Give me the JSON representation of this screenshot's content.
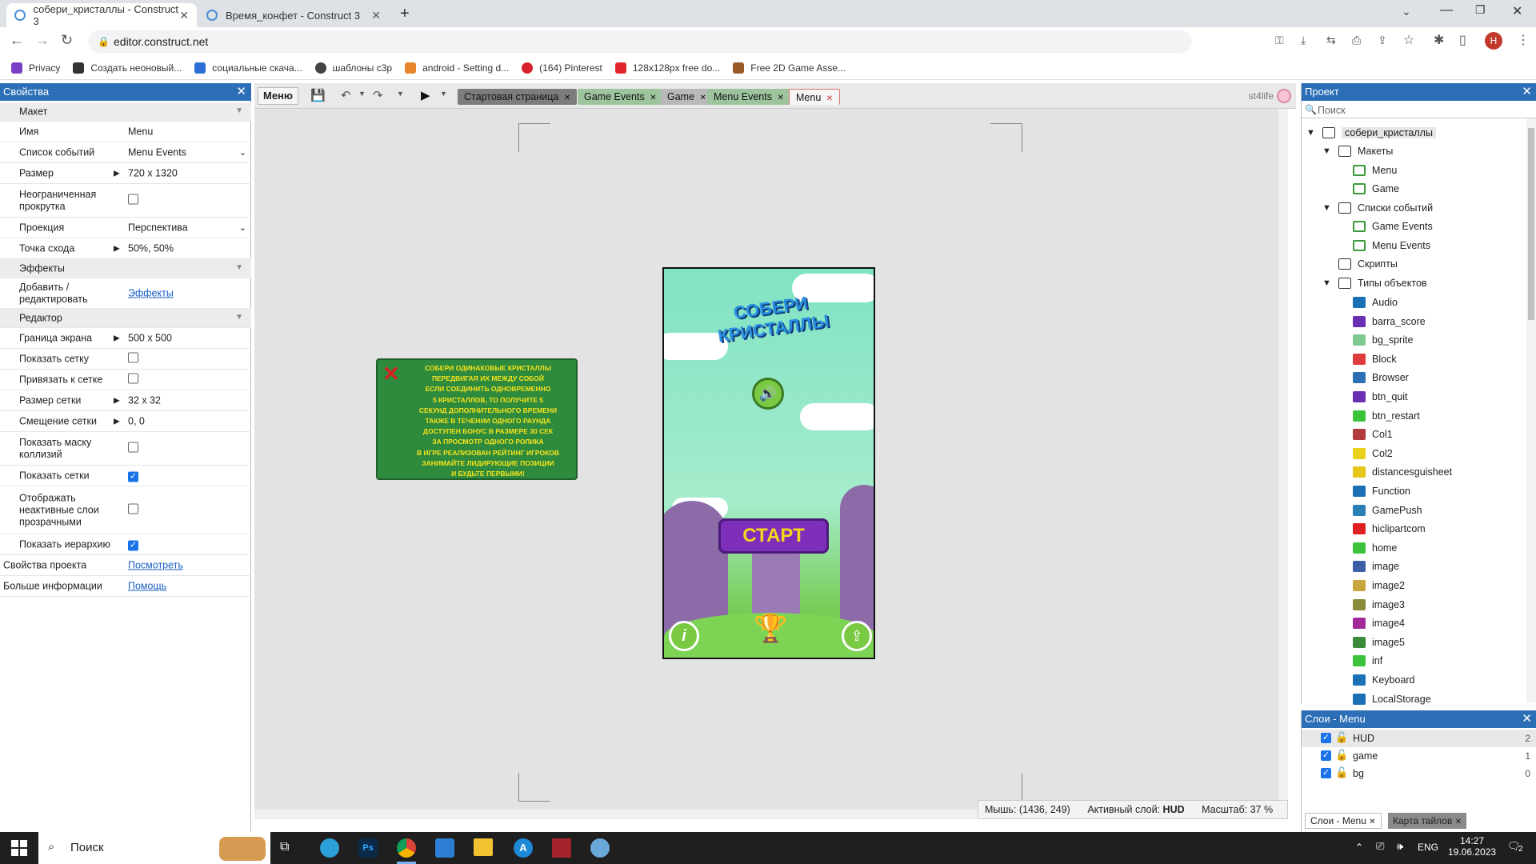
{
  "browser": {
    "tabs": [
      {
        "title": "собери_кристаллы - Construct 3",
        "active": true
      },
      {
        "title": "Время_конфет - Construct 3",
        "active": false
      }
    ],
    "new_tab": "+",
    "url": "editor.construct.net",
    "bookmarks": [
      "Privacy",
      "Создать неоновый...",
      "социальные скача...",
      "шаблоны c3p",
      "android - Setting d...",
      "(164) Pinterest",
      "128x128px free do...",
      "Free 2D Game Asse..."
    ],
    "profile_initial": "H"
  },
  "properties": {
    "title": "Свойства",
    "sections": {
      "layout": "Макет",
      "effects": "Эффекты",
      "editor": "Редактор"
    },
    "rows": {
      "name_k": "Имя",
      "name_v": "Menu",
      "events_k": "Список событий",
      "events_v": "Menu Events",
      "size_k": "Размер",
      "size_v": "720 x 1320",
      "unbounded_k": "Неограниченная прокрутка",
      "projection_k": "Проекция",
      "projection_v": "Перспектива",
      "vanish_k": "Точка схода",
      "vanish_v": "50%,  50%",
      "add_effects_k": "Добавить / редактировать",
      "add_effects_v": "Эффекты",
      "screen_border_k": "Граница экрана",
      "screen_border_v": "500 x 500",
      "show_grid_k": "Показать сетку",
      "snap_grid_k": "Привязать к сетке",
      "grid_size_k": "Размер сетки",
      "grid_size_v": "32 x 32",
      "grid_offset_k": "Смещение сетки",
      "grid_offset_v": "0,  0",
      "collision_k": "Показать маску коллизий",
      "show_meshes_k": "Показать сетки",
      "inactive_k": "Отображать неактивные слои прозрачными",
      "hierarchy_k": "Показать иерархию",
      "project_props_k": "Свойства проекта",
      "project_props_v": "Посмотреть",
      "more_info_k": "Больше информации",
      "more_info_v": "Помощь"
    },
    "checks": {
      "unbounded": false,
      "show_grid": false,
      "snap_grid": false,
      "collision": false,
      "show_meshes": true,
      "inactive": false,
      "hierarchy": true
    }
  },
  "editor": {
    "menu_label": "Меню",
    "tabs": [
      "Стартовая страница",
      "Game Events",
      "Game",
      "Menu Events",
      "Menu"
    ],
    "user": "st4life",
    "status": {
      "mouse_label": "Мышь:",
      "mouse_value": "(1436, 249)",
      "layer_label": "Активный слой:",
      "layer_value": "HUD",
      "zoom_label": "Масштаб:",
      "zoom_value": "37 %"
    },
    "game": {
      "title_line1": "СОБЕРИ",
      "title_line2": "КРИСТАЛЛЫ",
      "start": "СТАРТ",
      "info_icon": "i",
      "info_text": [
        "СОБЕРИ ОДИНАКОВЫЕ КРИСТАЛЛЫ",
        "ПЕРЕДВИГАЯ ИХ МЕЖДУ СОБОЙ",
        "ЕСЛИ СОЕДИНИТЬ ОДНОВРЕМЕННО",
        "5 КРИСТАЛЛОВ, ТО ПОЛУЧИТЕ 5",
        "СЕКУНД ДОПОЛНИТЕЛЬНОГО ВРЕМЕНИ",
        "ТАКЖЕ В ТЕЧЕНИИ ОДНОГО РАУНДА",
        "ДОСТУПЕН БОНУС В РАЗМЕРЕ 30 СЕК",
        "ЗА ПРОСМОТР ОДНОГО РОЛИКА",
        "В ИГРЕ РЕАЛИЗОВАН РЕЙТИНГ ИГРОКОВ",
        "ЗАНИМАЙТЕ ЛИДИРУЮЩИЕ ПОЗИЦИИ",
        "И БУДЬТЕ ПЕРВЫМИ!"
      ]
    }
  },
  "project": {
    "title": "Проект",
    "search_placeholder": "Поиск",
    "root": "собери_кристаллы",
    "layouts_folder": "Макеты",
    "layouts": [
      "Menu",
      "Game"
    ],
    "events_folder": "Списки событий",
    "events": [
      "Game Events",
      "Menu Events"
    ],
    "scripts_folder": "Скрипты",
    "types_folder": "Типы объектов",
    "objects": [
      {
        "name": "Audio",
        "color": "#1a6fb5"
      },
      {
        "name": "barra_score",
        "color": "#6b2fb3"
      },
      {
        "name": "bg_sprite",
        "color": "#7ec98f"
      },
      {
        "name": "Block",
        "color": "#e03b3b"
      },
      {
        "name": "Browser",
        "color": "#2c6fb5"
      },
      {
        "name": "btn_quit",
        "color": "#6b2fb3"
      },
      {
        "name": "btn_restart",
        "color": "#3cc33c"
      },
      {
        "name": "Col1",
        "color": "#b23b3b"
      },
      {
        "name": "Col2",
        "color": "#e8d21c"
      },
      {
        "name": "distancesguisheet",
        "color": "#e8c51c"
      },
      {
        "name": "Function",
        "color": "#1a6fb5"
      },
      {
        "name": "GamePush",
        "color": "#2a7fb5"
      },
      {
        "name": "hiclipartcom",
        "color": "#e02020"
      },
      {
        "name": "home",
        "color": "#3cc33c"
      },
      {
        "name": "image",
        "color": "#3a5fa5"
      },
      {
        "name": "image2",
        "color": "#c9a63b"
      },
      {
        "name": "image3",
        "color": "#8a8a3b"
      },
      {
        "name": "image4",
        "color": "#a02a9a"
      },
      {
        "name": "image5",
        "color": "#3c8a3c"
      },
      {
        "name": "inf",
        "color": "#3cc33c"
      },
      {
        "name": "Keyboard",
        "color": "#1a6fb5"
      },
      {
        "name": "LocalStorage",
        "color": "#1a6fb5"
      }
    ]
  },
  "layers": {
    "title": "Слои - Menu",
    "items": [
      {
        "name": "HUD",
        "index": "2"
      },
      {
        "name": "game",
        "index": "1"
      },
      {
        "name": "bg",
        "index": "0"
      }
    ],
    "bottom_tabs": [
      "Слои - Menu",
      "Карта тайлов"
    ]
  },
  "taskbar": {
    "search": "Поиск",
    "lang": "ENG",
    "time": "14:27",
    "date": "19.06.2023",
    "notifications": "2"
  }
}
